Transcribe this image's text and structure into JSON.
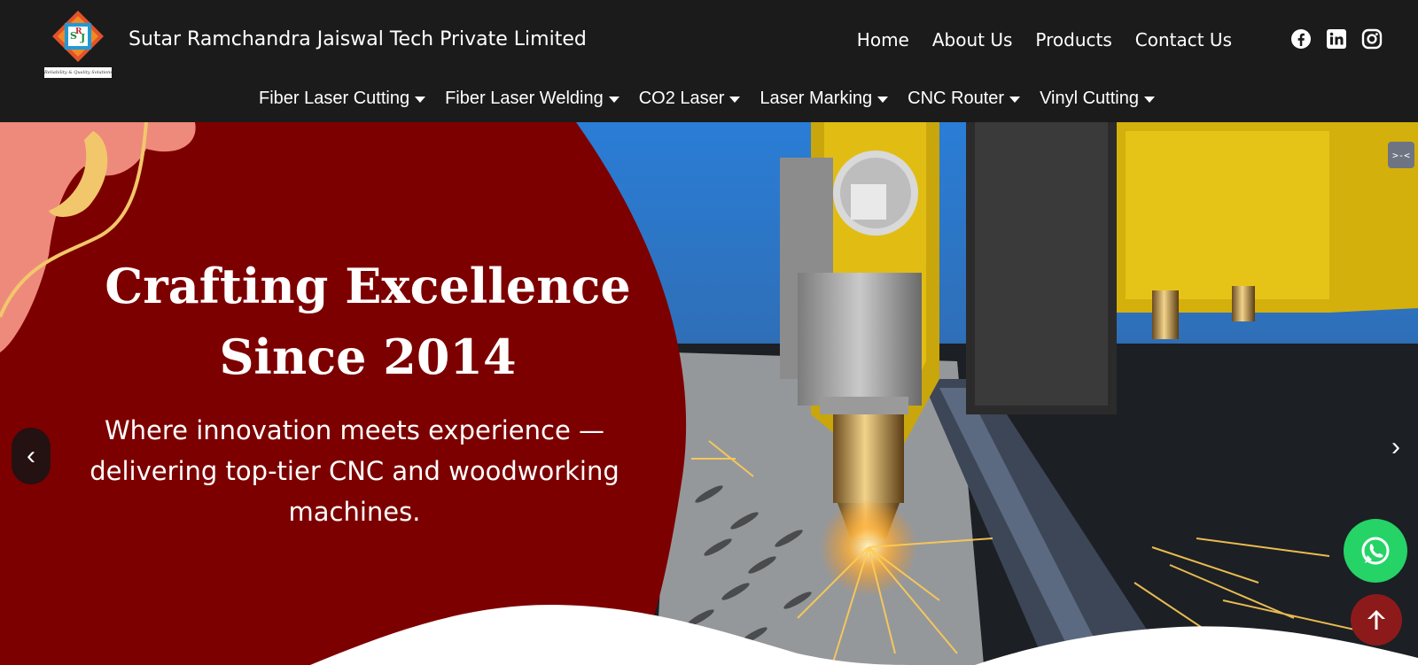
{
  "brand": {
    "company_name": "Sutar Ramchandra Jaiswal Tech Private Limited",
    "logo_letters": [
      "S",
      "R",
      "J"
    ],
    "logo_tagline": "Reliability & Quality Solutions"
  },
  "top_nav": {
    "items": [
      {
        "label": "Home"
      },
      {
        "label": "About Us"
      },
      {
        "label": "Products"
      },
      {
        "label": "Contact Us"
      }
    ]
  },
  "social": {
    "icons": [
      "facebook-icon",
      "linkedin-icon",
      "instagram-icon"
    ]
  },
  "category_nav": {
    "items": [
      {
        "label": "Fiber Laser Cutting"
      },
      {
        "label": "Fiber Laser Welding"
      },
      {
        "label": "CO2 Laser"
      },
      {
        "label": "Laser Marking"
      },
      {
        "label": "CNC Router"
      },
      {
        "label": "Vinyl Cutting"
      }
    ]
  },
  "hero": {
    "headline_line1": "Crafting Excellence",
    "headline_line2": "Since 2014",
    "subline_line1": "Where innovation meets experience —",
    "subline_line2": "delivering top-tier CNC and woodworking",
    "subline_line3": "machines.",
    "prev_label": "‹",
    "next_label": "›",
    "expand_label": ">-<"
  },
  "colors": {
    "header_bg": "#1b1b1b",
    "hero_red": "#7d0000",
    "accent_pink": "#ee8a7c",
    "accent_gold": "#f2c76b",
    "whatsapp_green": "#25d366",
    "to_top_red": "#8c1a1a"
  }
}
